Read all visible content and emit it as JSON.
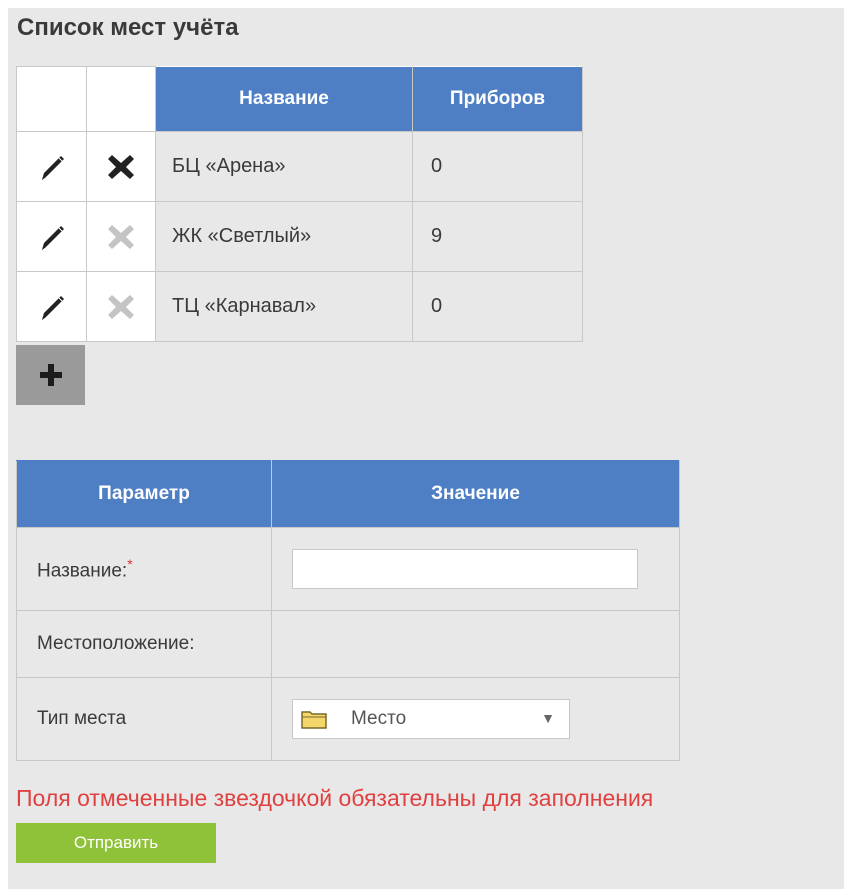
{
  "page_title": "Список мест учёта",
  "list_table": {
    "headers": {
      "edit": "",
      "delete": "",
      "name": "Название",
      "count": "Приборов"
    },
    "rows": [
      {
        "name": "БЦ «Арена»",
        "count": "0",
        "delete_enabled": true
      },
      {
        "name": "ЖК «Светлый»",
        "count": "9",
        "delete_enabled": false
      },
      {
        "name": "ТЦ «Карнавал»",
        "count": "0",
        "delete_enabled": false
      }
    ]
  },
  "add_button": {
    "icon": "plus-icon"
  },
  "form": {
    "headers": {
      "param": "Параметр",
      "value": "Значение"
    },
    "name_label": "Название:",
    "required_mark": "*",
    "name_value": "",
    "location_label": "Местоположение:",
    "type_label": "Тип места",
    "type_selected": "Место",
    "type_icon": "folder-icon"
  },
  "notice": "Поля отмеченные звездочкой обязательны для заполнения",
  "submit_label": "Отправить",
  "colors": {
    "header_blue": "#4e7fc4",
    "submit_green": "#8fc239",
    "notice_red": "#e04040",
    "panel_bg": "#e8e8e8"
  }
}
